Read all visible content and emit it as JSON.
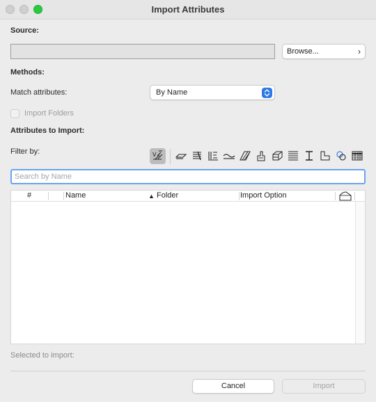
{
  "window": {
    "title": "Import Attributes"
  },
  "source": {
    "label": "Source:",
    "path_value": "",
    "browse_label": "Browse...",
    "browse_chevron": "›"
  },
  "methods": {
    "label": "Methods:",
    "match_label": "Match attributes:",
    "match_value": "By Name",
    "import_folders_label": "Import Folders",
    "import_folders_checked": false
  },
  "attributes": {
    "label": "Attributes to Import:",
    "filter_label": "Filter by:",
    "filter_icons": [
      "all-attributes-icon",
      "layers-icon",
      "line-types-icon",
      "pens-icon",
      "fill-types-icon",
      "fill-hatch-icon",
      "building-materials-icon",
      "composites-icon",
      "profiles-icon",
      "zones-icon",
      "surfaces-icon",
      "mep-systems-icon",
      "markup-styles-icon"
    ],
    "search_placeholder": "Search by Name",
    "search_value": ""
  },
  "table": {
    "columns": [
      "#",
      "Name",
      "▲",
      "Folder",
      "Import Option"
    ],
    "rows": []
  },
  "footer": {
    "selected_label": "Selected to import:",
    "cancel_label": "Cancel",
    "import_label": "Import"
  },
  "colors": {
    "accent": "#2f7ae5",
    "focus_ring": "#6aa3ee",
    "zoom_button": "#2ac940"
  }
}
